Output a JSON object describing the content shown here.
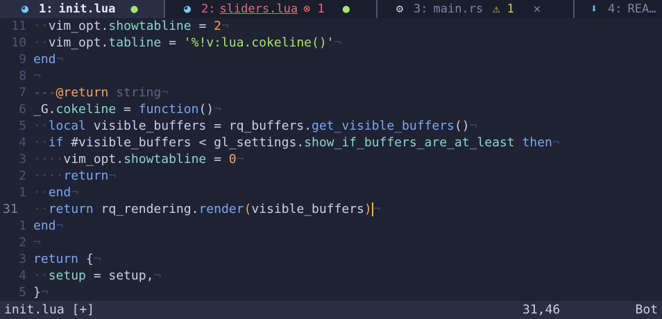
{
  "tabs": [
    {
      "icon": "lua-icon",
      "glyph": "◕",
      "num": "1:",
      "name": "init.lua",
      "status": "●"
    },
    {
      "icon": "lua-icon",
      "glyph": "◕",
      "num": "2:",
      "name": "sliders.lua",
      "error_badge": "⊗ 1",
      "status": "●"
    },
    {
      "icon": "rust-icon",
      "glyph": "⚙",
      "num": "3:",
      "name": "main.rs",
      "warning_badge": "⚠ 1",
      "close": "✕"
    },
    {
      "icon": "download-icon",
      "glyph": "⬇",
      "num": "4:",
      "name": "REA…"
    }
  ],
  "colors": {
    "keyword": "#7aa6f2",
    "field": "#8ad6c8",
    "string": "#a6e36f",
    "number": "#f0a45b",
    "comment": "#5c6488",
    "plain": "#c9cfe6",
    "accent": "#e36c7d"
  },
  "lines": [
    {
      "n": "11",
      "tokens": [
        {
          "t": "··",
          "c": "ws"
        },
        {
          "t": "vim_opt.",
          "c": "plain"
        },
        {
          "t": "showtabline",
          "c": "field"
        },
        {
          "t": " = ",
          "c": "plain"
        },
        {
          "t": "2",
          "c": "number"
        },
        {
          "t": "¬",
          "c": "ws"
        }
      ]
    },
    {
      "n": "10",
      "tokens": [
        {
          "t": "··",
          "c": "ws"
        },
        {
          "t": "vim_opt.",
          "c": "plain"
        },
        {
          "t": "tabline",
          "c": "field"
        },
        {
          "t": " = ",
          "c": "plain"
        },
        {
          "t": "'%!v:lua.cokeline()'",
          "c": "string"
        },
        {
          "t": "¬",
          "c": "ws"
        }
      ]
    },
    {
      "n": "9",
      "tokens": [
        {
          "t": "end",
          "c": "keyword"
        },
        {
          "t": "¬",
          "c": "ws"
        }
      ]
    },
    {
      "n": "8",
      "tokens": [
        {
          "t": "¬",
          "c": "ws"
        }
      ]
    },
    {
      "n": "7",
      "tokens": [
        {
          "t": "---",
          "c": "comment"
        },
        {
          "t": "@return",
          "c": "number"
        },
        {
          "t": " string",
          "c": "comment"
        },
        {
          "t": "¬",
          "c": "ws"
        }
      ]
    },
    {
      "n": "6",
      "tokens": [
        {
          "t": "_G.",
          "c": "plain"
        },
        {
          "t": "cokeline",
          "c": "field"
        },
        {
          "t": " = ",
          "c": "plain"
        },
        {
          "t": "function",
          "c": "keyword"
        },
        {
          "t": "()",
          "c": "plain"
        },
        {
          "t": "¬",
          "c": "ws"
        }
      ]
    },
    {
      "n": "5",
      "tokens": [
        {
          "t": "··",
          "c": "ws"
        },
        {
          "t": "local",
          "c": "keyword"
        },
        {
          "t": " visible_buffers = rq_buffers.",
          "c": "plain"
        },
        {
          "t": "get_visible_buffers",
          "c": "keyword"
        },
        {
          "t": "()",
          "c": "plain"
        },
        {
          "t": "¬",
          "c": "ws"
        }
      ]
    },
    {
      "n": "4",
      "tokens": [
        {
          "t": "··",
          "c": "ws"
        },
        {
          "t": "if",
          "c": "keyword"
        },
        {
          "t": " #visible_buffers < gl_settings.",
          "c": "plain"
        },
        {
          "t": "show_if_buffers_are_at_least",
          "c": "field"
        },
        {
          "t": " ",
          "c": "plain"
        },
        {
          "t": "then",
          "c": "keyword"
        },
        {
          "t": "¬",
          "c": "ws"
        }
      ]
    },
    {
      "n": "3",
      "tokens": [
        {
          "t": "····",
          "c": "ws"
        },
        {
          "t": "vim_opt.",
          "c": "plain"
        },
        {
          "t": "showtabline",
          "c": "field"
        },
        {
          "t": " = ",
          "c": "plain"
        },
        {
          "t": "0",
          "c": "number"
        },
        {
          "t": "¬",
          "c": "ws"
        }
      ]
    },
    {
      "n": "2",
      "tokens": [
        {
          "t": "····",
          "c": "ws"
        },
        {
          "t": "return",
          "c": "keyword"
        },
        {
          "t": "¬",
          "c": "ws"
        }
      ]
    },
    {
      "n": "1",
      "tokens": [
        {
          "t": "··",
          "c": "ws"
        },
        {
          "t": "end",
          "c": "keyword"
        },
        {
          "t": "¬",
          "c": "ws"
        }
      ]
    },
    {
      "n": "31",
      "current": true,
      "tokens": [
        {
          "t": "··",
          "c": "ws"
        },
        {
          "t": "return",
          "c": "keyword"
        },
        {
          "t": " rq_rendering.",
          "c": "plain"
        },
        {
          "t": "render",
          "c": "keyword"
        },
        {
          "t": "(",
          "c": "number"
        },
        {
          "t": "visible_buffers",
          "c": "plain"
        },
        {
          "t": ")",
          "c": "number"
        },
        {
          "t": "CURSOR",
          "c": "cursor"
        },
        {
          "t": "¬",
          "c": "ws"
        }
      ]
    },
    {
      "n": "1",
      "tokens": [
        {
          "t": "end",
          "c": "keyword"
        },
        {
          "t": "¬",
          "c": "ws"
        }
      ]
    },
    {
      "n": "2",
      "tokens": [
        {
          "t": "¬",
          "c": "ws"
        }
      ]
    },
    {
      "n": "3",
      "tokens": [
        {
          "t": "return",
          "c": "keyword"
        },
        {
          "t": " {",
          "c": "plain"
        },
        {
          "t": "¬",
          "c": "ws"
        }
      ]
    },
    {
      "n": "4",
      "tokens": [
        {
          "t": "··",
          "c": "ws"
        },
        {
          "t": "setup",
          "c": "field"
        },
        {
          "t": " = setup,",
          "c": "plain"
        },
        {
          "t": "¬",
          "c": "ws"
        }
      ]
    },
    {
      "n": "5",
      "tokens": [
        {
          "t": "}",
          "c": "plain"
        },
        {
          "t": "¬",
          "c": "ws"
        }
      ]
    }
  ],
  "statusline": {
    "file": "init.lua [+]",
    "position": "31,46",
    "scroll": "Bot"
  }
}
